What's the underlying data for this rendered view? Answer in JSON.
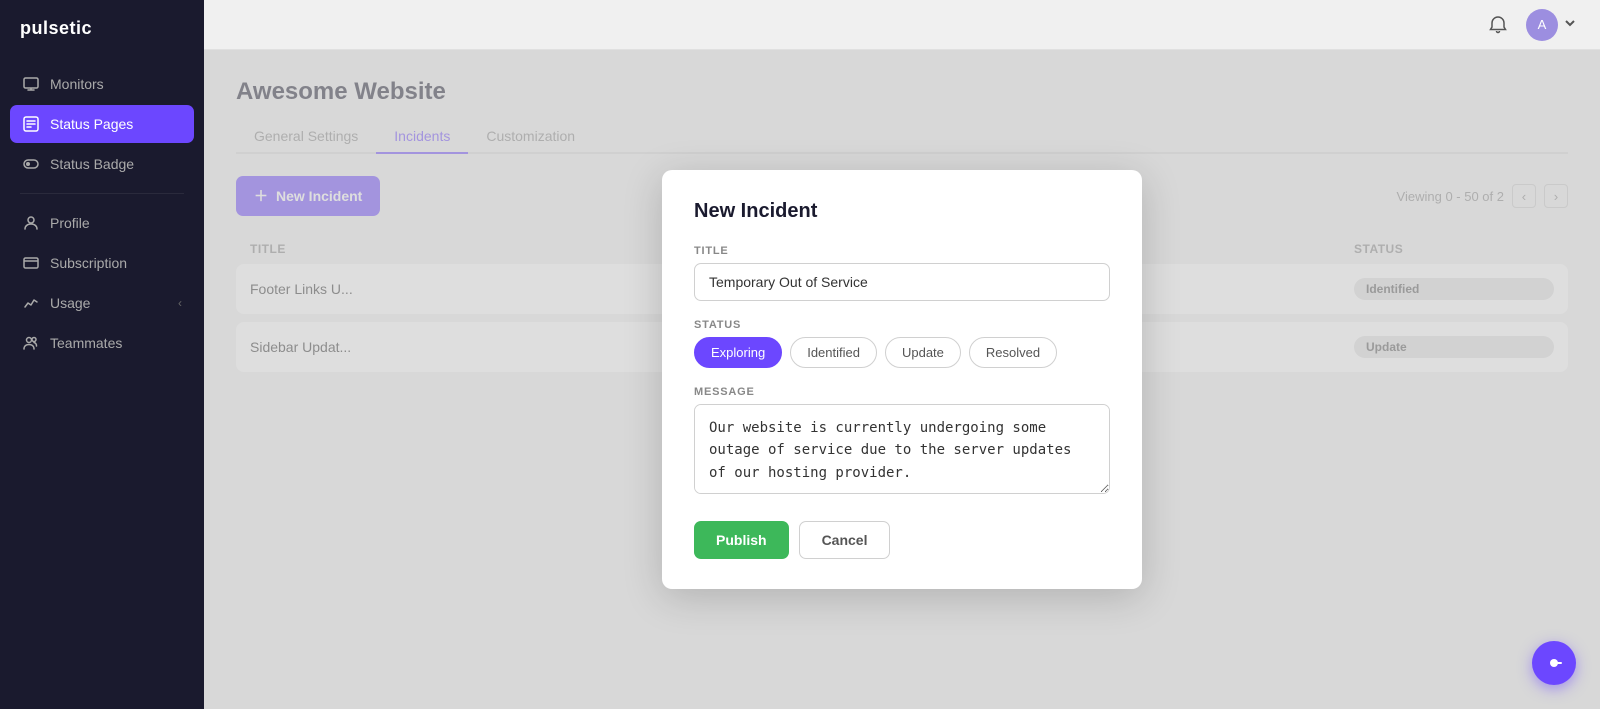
{
  "app": {
    "name": "pulsetic"
  },
  "sidebar": {
    "items": [
      {
        "id": "monitors",
        "label": "Monitors",
        "icon": "monitor-icon",
        "active": false
      },
      {
        "id": "status-pages",
        "label": "Status Pages",
        "icon": "status-pages-icon",
        "active": true
      },
      {
        "id": "status-badge",
        "label": "Status Badge",
        "icon": "status-badge-icon",
        "active": false
      },
      {
        "id": "profile",
        "label": "Profile",
        "icon": "profile-icon",
        "active": false
      },
      {
        "id": "subscription",
        "label": "Subscription",
        "icon": "subscription-icon",
        "active": false
      },
      {
        "id": "usage",
        "label": "Usage",
        "icon": "usage-icon",
        "active": false
      },
      {
        "id": "teammates",
        "label": "Teammates",
        "icon": "teammates-icon",
        "active": false
      }
    ]
  },
  "page": {
    "title": "Awesome Website",
    "tabs": [
      {
        "id": "general",
        "label": "General Settings",
        "active": false
      },
      {
        "id": "incidents",
        "label": "Incidents",
        "active": true
      },
      {
        "id": "customization",
        "label": "Customization",
        "active": false
      }
    ],
    "new_incident_button": "+ New Incident",
    "viewing_text": "Viewing 0 - 50 of 2",
    "table": {
      "columns": [
        "Title",
        "Status"
      ],
      "rows": [
        {
          "title": "Footer Links U...",
          "status": "Identified",
          "status_class": "badge-identified"
        },
        {
          "title": "Sidebar Updat...",
          "status": "Update",
          "status_class": "badge-update"
        }
      ]
    }
  },
  "modal": {
    "title": "New Incident",
    "title_label": "TITLE",
    "title_placeholder": "",
    "title_value": "Temporary Out of Service",
    "status_label": "STATUS",
    "status_options": [
      {
        "id": "exploring",
        "label": "Exploring",
        "active": true
      },
      {
        "id": "identified",
        "label": "Identified",
        "active": false
      },
      {
        "id": "update",
        "label": "Update",
        "active": false
      },
      {
        "id": "resolved",
        "label": "Resolved",
        "active": false
      }
    ],
    "message_label": "MESSAGE",
    "message_value": "Our website is currently undergoing some outage of service due to the server updates of our hosting provider.\n\nPlease be patient as we fix the ongoing issue with our service proider.",
    "publish_label": "Publish",
    "cancel_label": "Cancel"
  },
  "chat_btn_icon": "●—"
}
